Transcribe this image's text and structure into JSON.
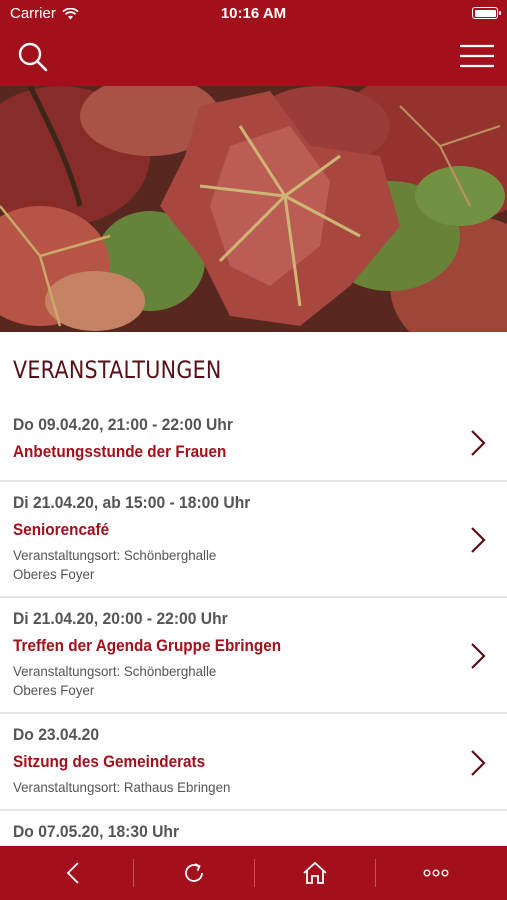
{
  "status_bar": {
    "carrier": "Carrier",
    "time": "10:16 AM"
  },
  "nav": {
    "search_icon": "search-icon",
    "menu_icon": "hamburger-menu-icon"
  },
  "section": {
    "title": "VERANSTALTUNGEN"
  },
  "events": [
    {
      "date": "Do 09.04.20, 21:00 - 22:00 Uhr",
      "title": "Anbetungsstunde der Frauen",
      "location_line1": "",
      "location_line2": ""
    },
    {
      "date": "Di 21.04.20, ab 15:00 - 18:00 Uhr",
      "title": "Seniorencafé",
      "location_line1": "Veranstaltungsort: Schönberghalle",
      "location_line2": "Oberes Foyer"
    },
    {
      "date": "Di 21.04.20, 20:00 - 22:00 Uhr",
      "title": "Treffen der Agenda Gruppe Ebringen",
      "location_line1": "Veranstaltungsort: Schönberghalle",
      "location_line2": "Oberes Foyer"
    },
    {
      "date": "Do 23.04.20",
      "title": "Sitzung des Gemeinderats",
      "location_line1": "Veranstaltungsort: Rathaus Ebringen",
      "location_line2": ""
    },
    {
      "date": "Do 07.05.20, 18:30 Uhr",
      "title": "",
      "location_line1": "",
      "location_line2": ""
    }
  ],
  "tab_bar": {
    "icons": [
      "back-icon",
      "refresh-icon",
      "home-icon",
      "more-icon"
    ]
  },
  "colors": {
    "brand": "#a30f1a",
    "heading": "#5a0f16",
    "text": "#555555",
    "divider": "#e6e6e6"
  }
}
